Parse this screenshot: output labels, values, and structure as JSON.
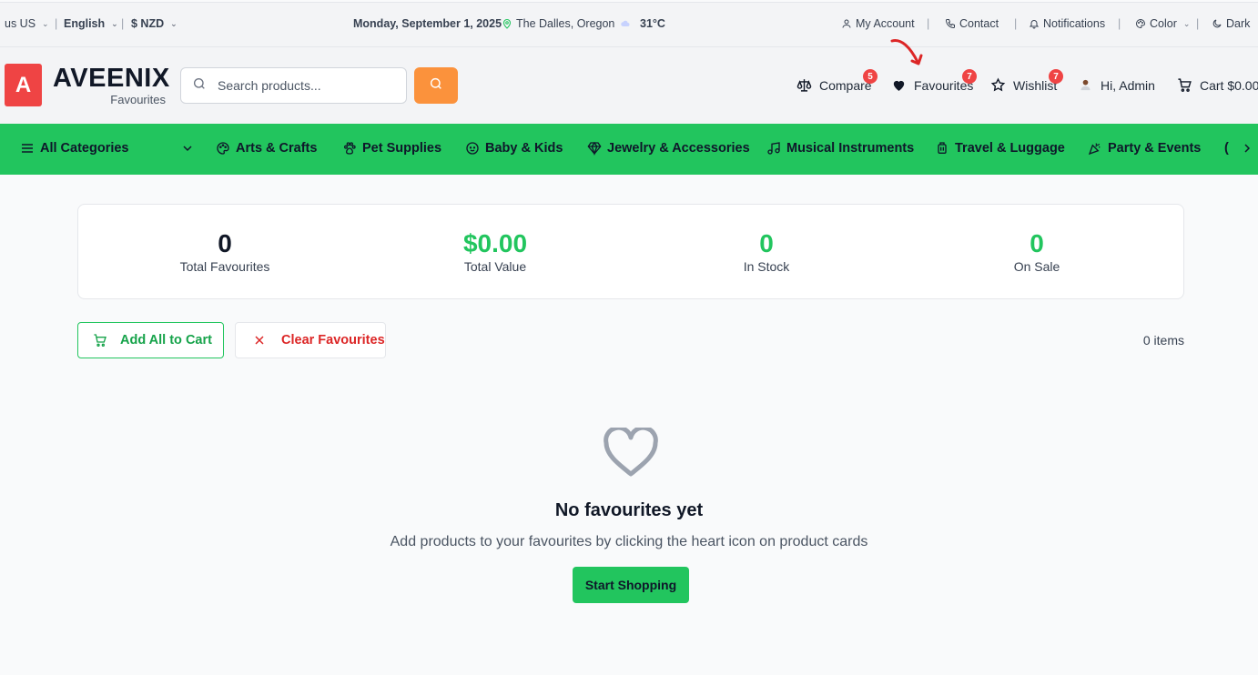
{
  "topbar": {
    "country": "us US",
    "language": "English",
    "currency": "$ NZD",
    "date": "Monday, September 1, 2025",
    "location": "The Dalles, Oregon",
    "temperature": "31°C",
    "my_account": "My Account",
    "contact": "Contact",
    "notifications": "Notifications",
    "color": "Color",
    "dark": "Dark"
  },
  "header": {
    "logo_letter": "A",
    "brand": "AVEENIX",
    "subtitle": "Favourites",
    "search_placeholder": "Search products...",
    "compare": "Compare",
    "compare_count": "5",
    "favourites": "Favourites",
    "favourites_count": "7",
    "wishlist": "Wishlist",
    "wishlist_count": "7",
    "greeting": "Hi, Admin",
    "cart": "Cart $0.00"
  },
  "nav": {
    "all_categories": "All Categories",
    "items": [
      "Arts & Crafts",
      "Pet Supplies",
      "Baby & Kids",
      "Jewelry & Accessories",
      "Musical Instruments",
      "Travel & Luggage",
      "Party & Events"
    ]
  },
  "stats": [
    {
      "value": "0",
      "label": "Total Favourites",
      "color": "#111827"
    },
    {
      "value": "$0.00",
      "label": "Total Value",
      "color": "#22c55e"
    },
    {
      "value": "0",
      "label": "In Stock",
      "color": "#22c55e"
    },
    {
      "value": "0",
      "label": "On Sale",
      "color": "#22c55e"
    }
  ],
  "actions": {
    "add_all": "Add All to Cart",
    "clear": "Clear Favourites",
    "items_count": "0 items"
  },
  "empty": {
    "title": "No favourites yet",
    "description": "Add products to your favourites by clicking the heart icon on product cards",
    "button": "Start Shopping"
  },
  "colors": {
    "accent_green": "#22c55e",
    "accent_orange": "#fb923c",
    "brand_red": "#ef4444"
  }
}
